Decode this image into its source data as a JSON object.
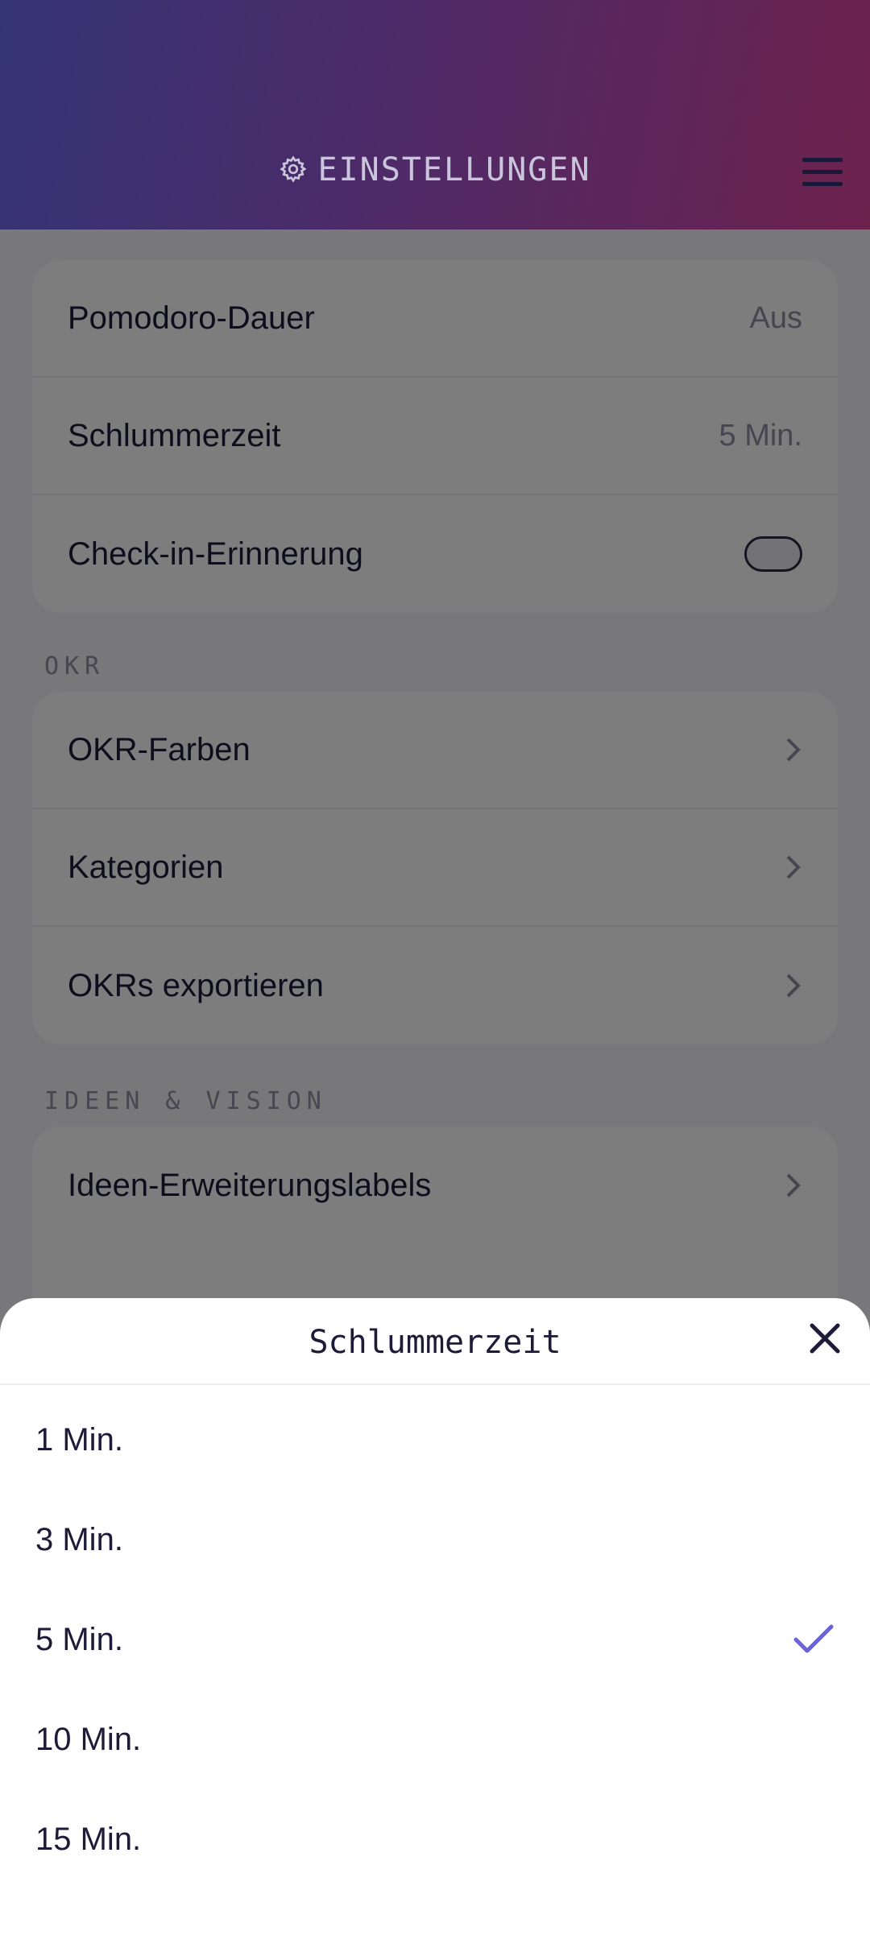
{
  "header": {
    "title": "EINSTELLUNGEN"
  },
  "general_card": {
    "items": [
      {
        "label": "Pomodoro-Dauer",
        "value": "Aus"
      },
      {
        "label": "Schlummerzeit",
        "value": "5 Min."
      },
      {
        "label": "Check-in-Erinnerung",
        "toggle": false
      }
    ]
  },
  "okr_section": {
    "title": "OKR",
    "items": [
      {
        "label": "OKR-Farben"
      },
      {
        "label": "Kategorien"
      },
      {
        "label": "OKRs exportieren"
      }
    ]
  },
  "ideas_section": {
    "title": "IDEEN & VISION",
    "items": [
      {
        "label": "Ideen-Erweiterungslabels"
      }
    ]
  },
  "sheet": {
    "title": "Schlummerzeit",
    "options": [
      {
        "label": "1 Min."
      },
      {
        "label": "3 Min."
      },
      {
        "label": "5 Min.",
        "selected": true
      },
      {
        "label": "10 Min."
      },
      {
        "label": "15 Min."
      }
    ]
  },
  "colors": {
    "accent": "#6b63d8",
    "header_start": "#343474",
    "header_end": "#6d224d",
    "text": "#1d1b38"
  }
}
